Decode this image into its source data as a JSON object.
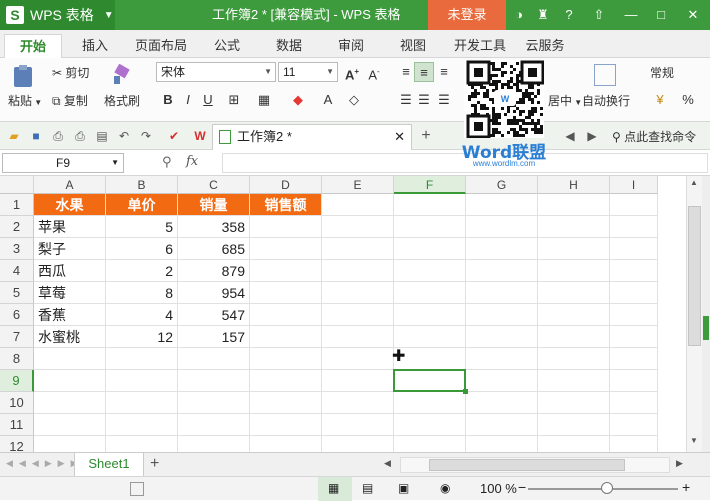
{
  "app": {
    "logo_letter": "S",
    "name": "WPS 表格",
    "title": "工作簿2 * [兼容模式] - WPS 表格",
    "login_label": "未登录"
  },
  "tabs": [
    {
      "label": "开始"
    },
    {
      "label": "插入"
    },
    {
      "label": "页面布局"
    },
    {
      "label": "公式"
    },
    {
      "label": "数据"
    },
    {
      "label": "审阅"
    },
    {
      "label": "视图"
    },
    {
      "label": "开发工具"
    },
    {
      "label": "云服务"
    }
  ],
  "ribbon": {
    "paste": "粘贴",
    "cut": "剪切",
    "copy": "复制",
    "format_painter": "格式刷",
    "font": "宋体",
    "font_size": "11",
    "bold": "B",
    "italic": "I",
    "underline": "U",
    "wrap_text": "自动换行",
    "merge_center_partial": "居中",
    "number_format": "常规",
    "percent": "%"
  },
  "quickbar": {
    "doc_tab": "工作簿2 *",
    "find_command": "点此查找命令"
  },
  "formula_bar": {
    "name_box": "F9",
    "fx": "fx",
    "content": ""
  },
  "columns": [
    "A",
    "B",
    "C",
    "D",
    "E",
    "F",
    "G",
    "H",
    "I"
  ],
  "rows": [
    "1",
    "2",
    "3",
    "4",
    "5",
    "6",
    "7",
    "8",
    "9",
    "10",
    "11",
    "12"
  ],
  "table": {
    "headers": [
      "水果",
      "单价",
      "销量",
      "销售额"
    ],
    "data": [
      [
        "苹果",
        "5",
        "358"
      ],
      [
        "梨子",
        "6",
        "685"
      ],
      [
        "西瓜",
        "2",
        "879"
      ],
      [
        "草莓",
        "8",
        "954"
      ],
      [
        "香蕉",
        "4",
        "547"
      ],
      [
        "水蜜桃",
        "12",
        "157"
      ]
    ]
  },
  "sheet": {
    "tab": "Sheet1",
    "add": "+"
  },
  "status": {
    "zoom": "100 %"
  },
  "watermark": {
    "brand": "Word联盟",
    "url": "www.wordlm.com"
  },
  "colors": {
    "title_green": "#3d9a3d",
    "header_orange": "#f26b12",
    "login_orange": "#e96a3c",
    "selection_green": "#3a9a3a"
  }
}
